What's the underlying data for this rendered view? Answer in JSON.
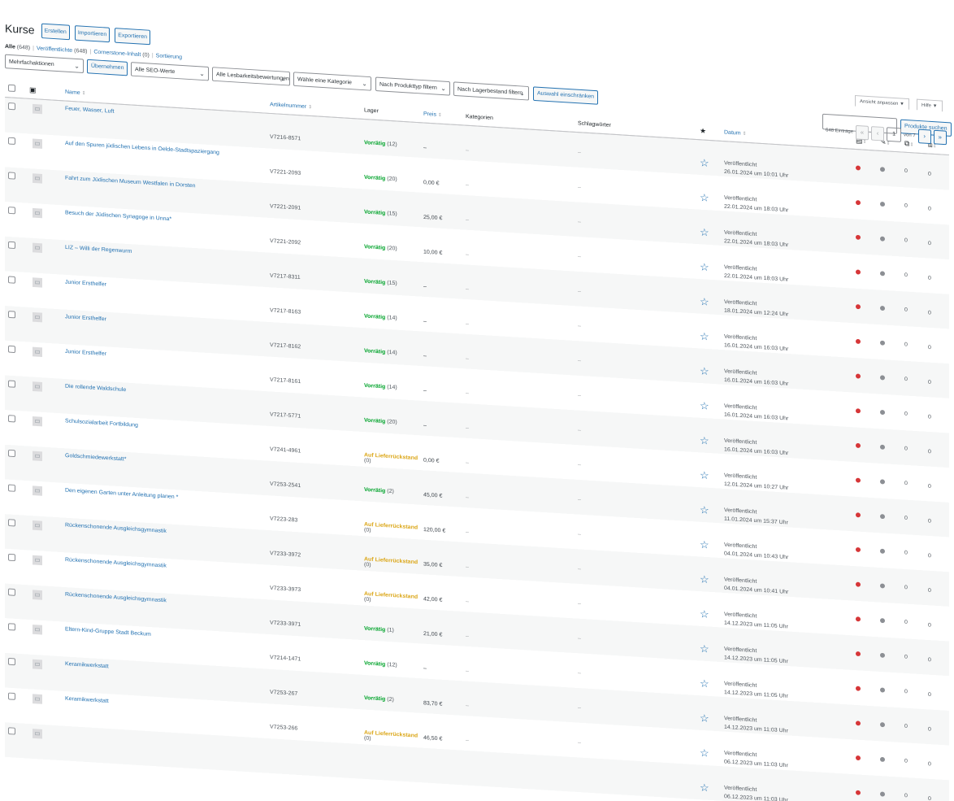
{
  "header": {
    "title": "Kurse",
    "buttons": [
      "Erstellen",
      "Importieren",
      "Exportieren"
    ]
  },
  "subsub": [
    {
      "label": "Alle",
      "count": "(648)",
      "current": true
    },
    {
      "label": "Veröffentlichte",
      "count": "(648)",
      "current": false
    },
    {
      "label": "Cornerstone-Inhalt",
      "count": "(0)",
      "current": false
    },
    {
      "label": "Sortierung",
      "count": "",
      "current": false
    }
  ],
  "filters": {
    "bulk_action": "Mehrfachaktionen",
    "apply": "Übernehmen",
    "seo": "Alle SEO-Werte",
    "readability": "Alle Lesbarkeitsbewertungen",
    "category": "Wähle eine Kategorie",
    "product_type": "Nach Produkttyp filtern",
    "stock": "Nach Lagerbestand filtern",
    "narrow": "Auswahl einschränken"
  },
  "screen_options": {
    "view": "Ansicht anpassen ▼",
    "help": "Hilfe ▼"
  },
  "search": {
    "button": "Produkte suchen",
    "placeholder": ""
  },
  "pagination": {
    "entries": "648 Einträge",
    "first": "«",
    "prev": "‹",
    "current": "1",
    "of": "von 7",
    "next": "›",
    "last": "»"
  },
  "columns": {
    "name": "Name",
    "sku": "Artikelnummer",
    "stock": "Lager",
    "price": "Preis",
    "categories": "Kategorien",
    "tags": "Schlagwörter",
    "featured": "★",
    "date": "Datum"
  },
  "rows": [
    {
      "name": "Feuer, Wasser, Luft",
      "sku": "V7216-8571",
      "stock": "Vorrätig",
      "stock_count": "(12)",
      "stock_type": "in",
      "price": "–",
      "cat": "–",
      "tags": "–",
      "status": "Veröffentlicht",
      "date": "26.01.2024 um 10:01 Uhr",
      "r1": "0",
      "r2": "0"
    },
    {
      "name": "Auf den Spuren jüdischen Lebens in Oelde-Stadtspaziergang",
      "sku": "V7221-2093",
      "stock": "Vorrätig",
      "stock_count": "(20)",
      "stock_type": "in",
      "price": "0,00 €",
      "cat": "–",
      "tags": "–",
      "status": "Veröffentlicht",
      "date": "22.01.2024 um 18:03 Uhr",
      "r1": "0",
      "r2": "0"
    },
    {
      "name": "Fahrt zum Jüdischen Museum Westfalen in Dorsten",
      "sku": "V7221-2091",
      "stock": "Vorrätig",
      "stock_count": "(15)",
      "stock_type": "in",
      "price": "25,00 €",
      "cat": "–",
      "tags": "–",
      "status": "Veröffentlicht",
      "date": "22.01.2024 um 18:03 Uhr",
      "r1": "0",
      "r2": "0"
    },
    {
      "name": "Besuch der Jüdischen Synagoge in Unna*",
      "sku": "V7221-2092",
      "stock": "Vorrätig",
      "stock_count": "(20)",
      "stock_type": "in",
      "price": "10,00 €",
      "cat": "–",
      "tags": "–",
      "status": "Veröffentlicht",
      "date": "22.01.2024 um 18:03 Uhr",
      "r1": "0",
      "r2": "0"
    },
    {
      "name": "LIZ – Willi der Regenwurm",
      "sku": "V7217-8311",
      "stock": "Vorrätig",
      "stock_count": "(15)",
      "stock_type": "in",
      "price": "–",
      "cat": "–",
      "tags": "–",
      "status": "Veröffentlicht",
      "date": "18.01.2024 um 12:24 Uhr",
      "r1": "0",
      "r2": "0"
    },
    {
      "name": "Junior Ersthelfer",
      "sku": "V7217-8163",
      "stock": "Vorrätig",
      "stock_count": "(14)",
      "stock_type": "in",
      "price": "–",
      "cat": "–",
      "tags": "–",
      "status": "Veröffentlicht",
      "date": "16.01.2024 um 16:03 Uhr",
      "r1": "0",
      "r2": "0"
    },
    {
      "name": "Junior Ersthelfer",
      "sku": "V7217-8162",
      "stock": "Vorrätig",
      "stock_count": "(14)",
      "stock_type": "in",
      "price": "–",
      "cat": "–",
      "tags": "–",
      "status": "Veröffentlicht",
      "date": "16.01.2024 um 16:03 Uhr",
      "r1": "0",
      "r2": "0"
    },
    {
      "name": "Junior Ersthelfer",
      "sku": "V7217-8161",
      "stock": "Vorrätig",
      "stock_count": "(14)",
      "stock_type": "in",
      "price": "–",
      "cat": "–",
      "tags": "–",
      "status": "Veröffentlicht",
      "date": "16.01.2024 um 16:03 Uhr",
      "r1": "0",
      "r2": "0"
    },
    {
      "name": "Die rollende Waldschule",
      "sku": "V7217-5771",
      "stock": "Vorrätig",
      "stock_count": "(20)",
      "stock_type": "in",
      "price": "–",
      "cat": "–",
      "tags": "–",
      "status": "Veröffentlicht",
      "date": "16.01.2024 um 16:03 Uhr",
      "r1": "0",
      "r2": "0"
    },
    {
      "name": "Schulsozialarbeit Fortbildung",
      "sku": "V7241-4961",
      "stock": "Auf Lieferrückstand",
      "stock_count": "(0)",
      "stock_type": "back",
      "price": "0,00 €",
      "cat": "–",
      "tags": "–",
      "status": "Veröffentlicht",
      "date": "12.01.2024 um 10:27 Uhr",
      "r1": "0",
      "r2": "0"
    },
    {
      "name": "Goldschmiedewerkstatt*",
      "sku": "V7253-2541",
      "stock": "Vorrätig",
      "stock_count": "(2)",
      "stock_type": "in",
      "price": "45,00 €",
      "cat": "–",
      "tags": "–",
      "status": "Veröffentlicht",
      "date": "11.01.2024 um 15:37 Uhr",
      "r1": "0",
      "r2": "0"
    },
    {
      "name": "Den eigenen Garten unter Anleitung planen *",
      "sku": "V7223-283",
      "stock": "Auf Lieferrückstand",
      "stock_count": "(0)",
      "stock_type": "back",
      "price": "120,00 €",
      "cat": "–",
      "tags": "–",
      "status": "Veröffentlicht",
      "date": "04.01.2024 um 10:43 Uhr",
      "r1": "0",
      "r2": "0"
    },
    {
      "name": "Rückenschonende Ausgleichsgymnastik",
      "sku": "V7233-3972",
      "stock": "Auf Lieferrückstand",
      "stock_count": "(0)",
      "stock_type": "back",
      "price": "35,00 €",
      "cat": "–",
      "tags": "–",
      "status": "Veröffentlicht",
      "date": "04.01.2024 um 10:41 Uhr",
      "r1": "0",
      "r2": "0"
    },
    {
      "name": "Rückenschonende Ausgleichsgymnastik",
      "sku": "V7233-3973",
      "stock": "Auf Lieferrückstand",
      "stock_count": "(0)",
      "stock_type": "back",
      "price": "42,00 €",
      "cat": "–",
      "tags": "–",
      "status": "Veröffentlicht",
      "date": "14.12.2023 um 11:05 Uhr",
      "r1": "0",
      "r2": "0"
    },
    {
      "name": "Rückenschonende Ausgleichsgymnastik",
      "sku": "V7233-3971",
      "stock": "Vorrätig",
      "stock_count": "(1)",
      "stock_type": "in",
      "price": "21,00 €",
      "cat": "–",
      "tags": "–",
      "status": "Veröffentlicht",
      "date": "14.12.2023 um 11:05 Uhr",
      "r1": "0",
      "r2": "0"
    },
    {
      "name": "Eltern-Kind-Gruppe Stadt Beckum",
      "sku": "V7214-1471",
      "stock": "Vorrätig",
      "stock_count": "(12)",
      "stock_type": "in",
      "price": "–",
      "cat": "–",
      "tags": "–",
      "status": "Veröffentlicht",
      "date": "14.12.2023 um 11:05 Uhr",
      "r1": "0",
      "r2": "0"
    },
    {
      "name": "Keramikwerkstatt",
      "sku": "V7253-267",
      "stock": "Vorrätig",
      "stock_count": "(2)",
      "stock_type": "in",
      "price": "83,70 €",
      "cat": "–",
      "tags": "–",
      "status": "Veröffentlicht",
      "date": "14.12.2023 um 11:03 Uhr",
      "r1": "0",
      "r2": "0"
    },
    {
      "name": "Keramikwerkstatt",
      "sku": "V7253-266",
      "stock": "Auf Lieferrückstand",
      "stock_count": "(0)",
      "stock_type": "back",
      "price": "46,50 €",
      "cat": "–",
      "tags": "–",
      "status": "Veröffentlicht",
      "date": "06.12.2023 um 11:03 Uhr",
      "r1": "0",
      "r2": "0"
    },
    {
      "name": "",
      "sku": "",
      "stock": "",
      "stock_count": "",
      "stock_type": "in",
      "price": "",
      "cat": "",
      "tags": "",
      "status": "Veröffentlicht",
      "date": "06.12.2023 um 11:03 Uhr",
      "r1": "0",
      "r2": "0"
    }
  ],
  "colors": {
    "link": "#2271b1",
    "in_stock": "#00a32a",
    "backorder": "#dba617",
    "seo_bad": "#d63638",
    "neutral": "#8c8f94"
  }
}
